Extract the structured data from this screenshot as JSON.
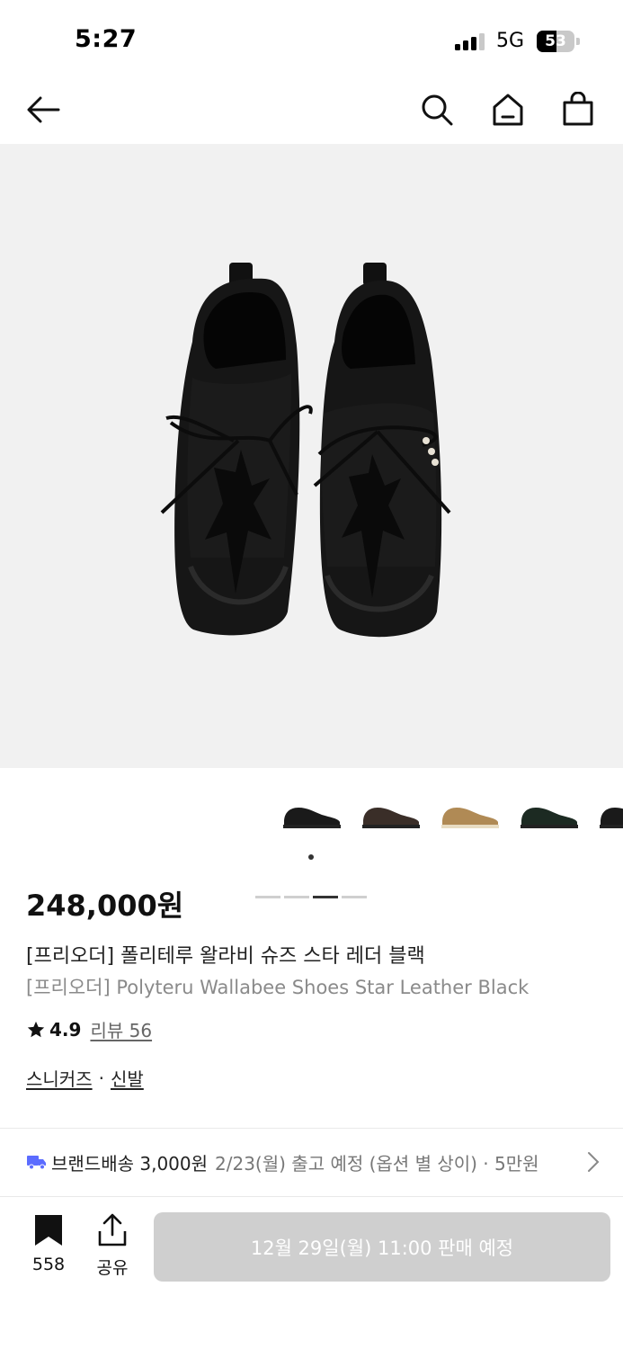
{
  "status": {
    "time": "5:27",
    "network": "5G",
    "battery": "53",
    "battery_level": 0.53
  },
  "nav": {
    "icons": [
      "back-arrow-icon",
      "search-icon",
      "home-icon",
      "shopping-bag-icon"
    ]
  },
  "gallery": {
    "page_count": 4,
    "active_page": 3,
    "thumbnail_colors": [
      "#1a1a1a",
      "#3a2e28",
      "#b08a55",
      "#1c2a22",
      "#1a1a1a"
    ],
    "active_thumbnail": 1
  },
  "product": {
    "price": "248,000원",
    "title_ko": "[프리오더] 폴리테루 왈라비 슈즈 스타 레더 블랙",
    "title_en": "[프리오더] Polyteru Wallabee Shoes Star Leather Black",
    "rating": "4.9",
    "review_label": "리뷰 56",
    "category_1": "스니커즈",
    "category_separator": "·",
    "category_2": "신발"
  },
  "shipping": {
    "label": "브랜드배송 3,000원",
    "detail": "2/23(월) 출고 예정 (옵션 별 상이) · 5만원"
  },
  "bottom": {
    "bookmark_count": "558",
    "share_label": "공유",
    "cta_label": "12월 29일(월) 11:00 판매 예정"
  },
  "colors": {
    "accent_truck": "#5b6cff",
    "cta_disabled": "#cfcfcf",
    "hero_bg": "#f1f1f1"
  }
}
